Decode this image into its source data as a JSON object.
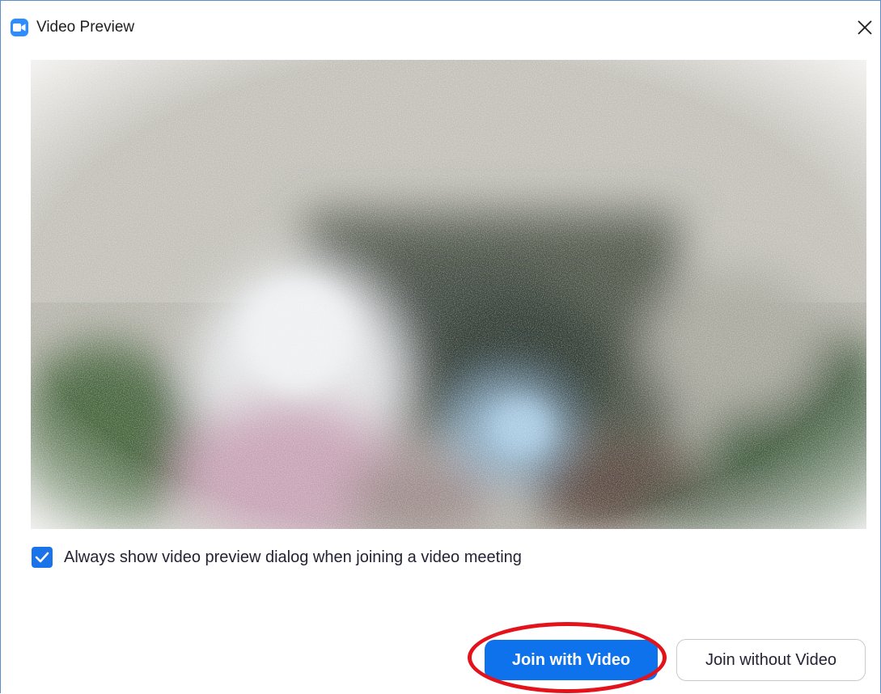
{
  "window": {
    "title": "Video Preview",
    "app_icon": "zoom-camera-icon",
    "close_icon": "close-icon",
    "border_color": "#5b8ec9"
  },
  "preview": {
    "content": "blurred-webcam-feed"
  },
  "options": {
    "always_show_preview_label": "Always show video preview dialog when joining a video meeting",
    "always_show_preview_checked": true,
    "checkbox_color": "#1a73e8"
  },
  "actions": {
    "join_with_video_label": "Join with Video",
    "join_without_video_label": "Join without Video",
    "primary_color": "#0e72ed",
    "annotation_color": "#e3121b"
  }
}
